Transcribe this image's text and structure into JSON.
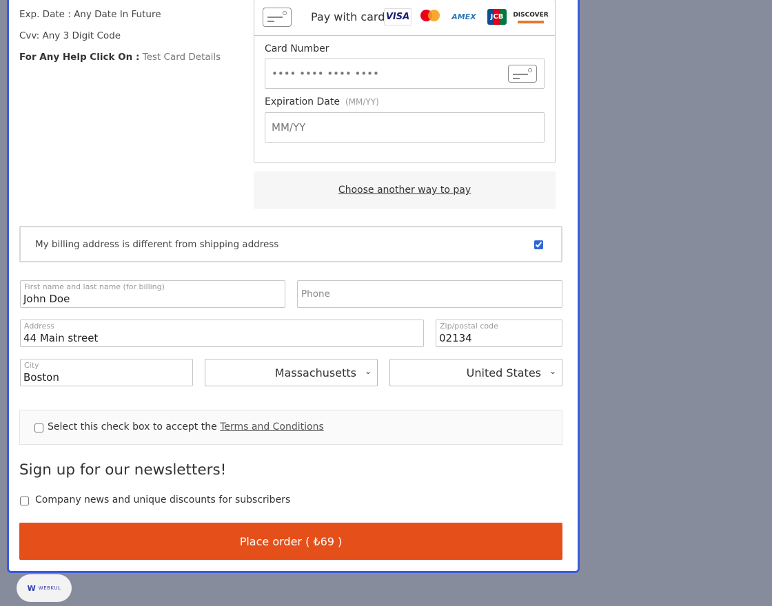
{
  "test_info": {
    "exp_date": "Exp. Date : Any Date In Future",
    "cvv": "Cvv: Any 3 Digit Code",
    "help_label": "For Any Help Click On :",
    "help_link": "Test Card Details"
  },
  "card_form": {
    "pay_with_label": "Pay with card",
    "brands": [
      "VISA",
      "mastercard",
      "AMEX",
      "JCB",
      "DISCOVER"
    ],
    "card_number_label": "Card Number",
    "card_number_placeholder": "•••• •••• •••• ••••",
    "expiration_label": "Expiration Date",
    "expiration_hint": "(MM/YY)",
    "expiration_placeholder": "MM/YY",
    "another_way": "Choose another way to pay"
  },
  "billing": {
    "different_address_label": "My billing address is different from shipping address",
    "different_address_checked": true,
    "name_label": "First name and last name (for billing)",
    "name_value": "John Doe",
    "phone_placeholder": "Phone",
    "address_label": "Address",
    "address_value": "44 Main street",
    "zip_label": "Zip/postal code",
    "zip_value": "02134",
    "city_label": "City",
    "city_value": "Boston",
    "state_value": "Massachusetts",
    "country_value": "United States"
  },
  "terms": {
    "text": "Select this check box to accept the",
    "link": "Terms and Conditions"
  },
  "newsletter": {
    "title": "Sign up for our newsletters!",
    "option": "Company news and unique discounts for subscribers"
  },
  "place_order": "Place order ( ₺69 )",
  "badge": {
    "logo": "W",
    "text": "WEBKUL"
  },
  "colors": {
    "accent": "#e54f1a",
    "modal_border": "#3b5bdb",
    "backdrop": "#878c9d"
  }
}
